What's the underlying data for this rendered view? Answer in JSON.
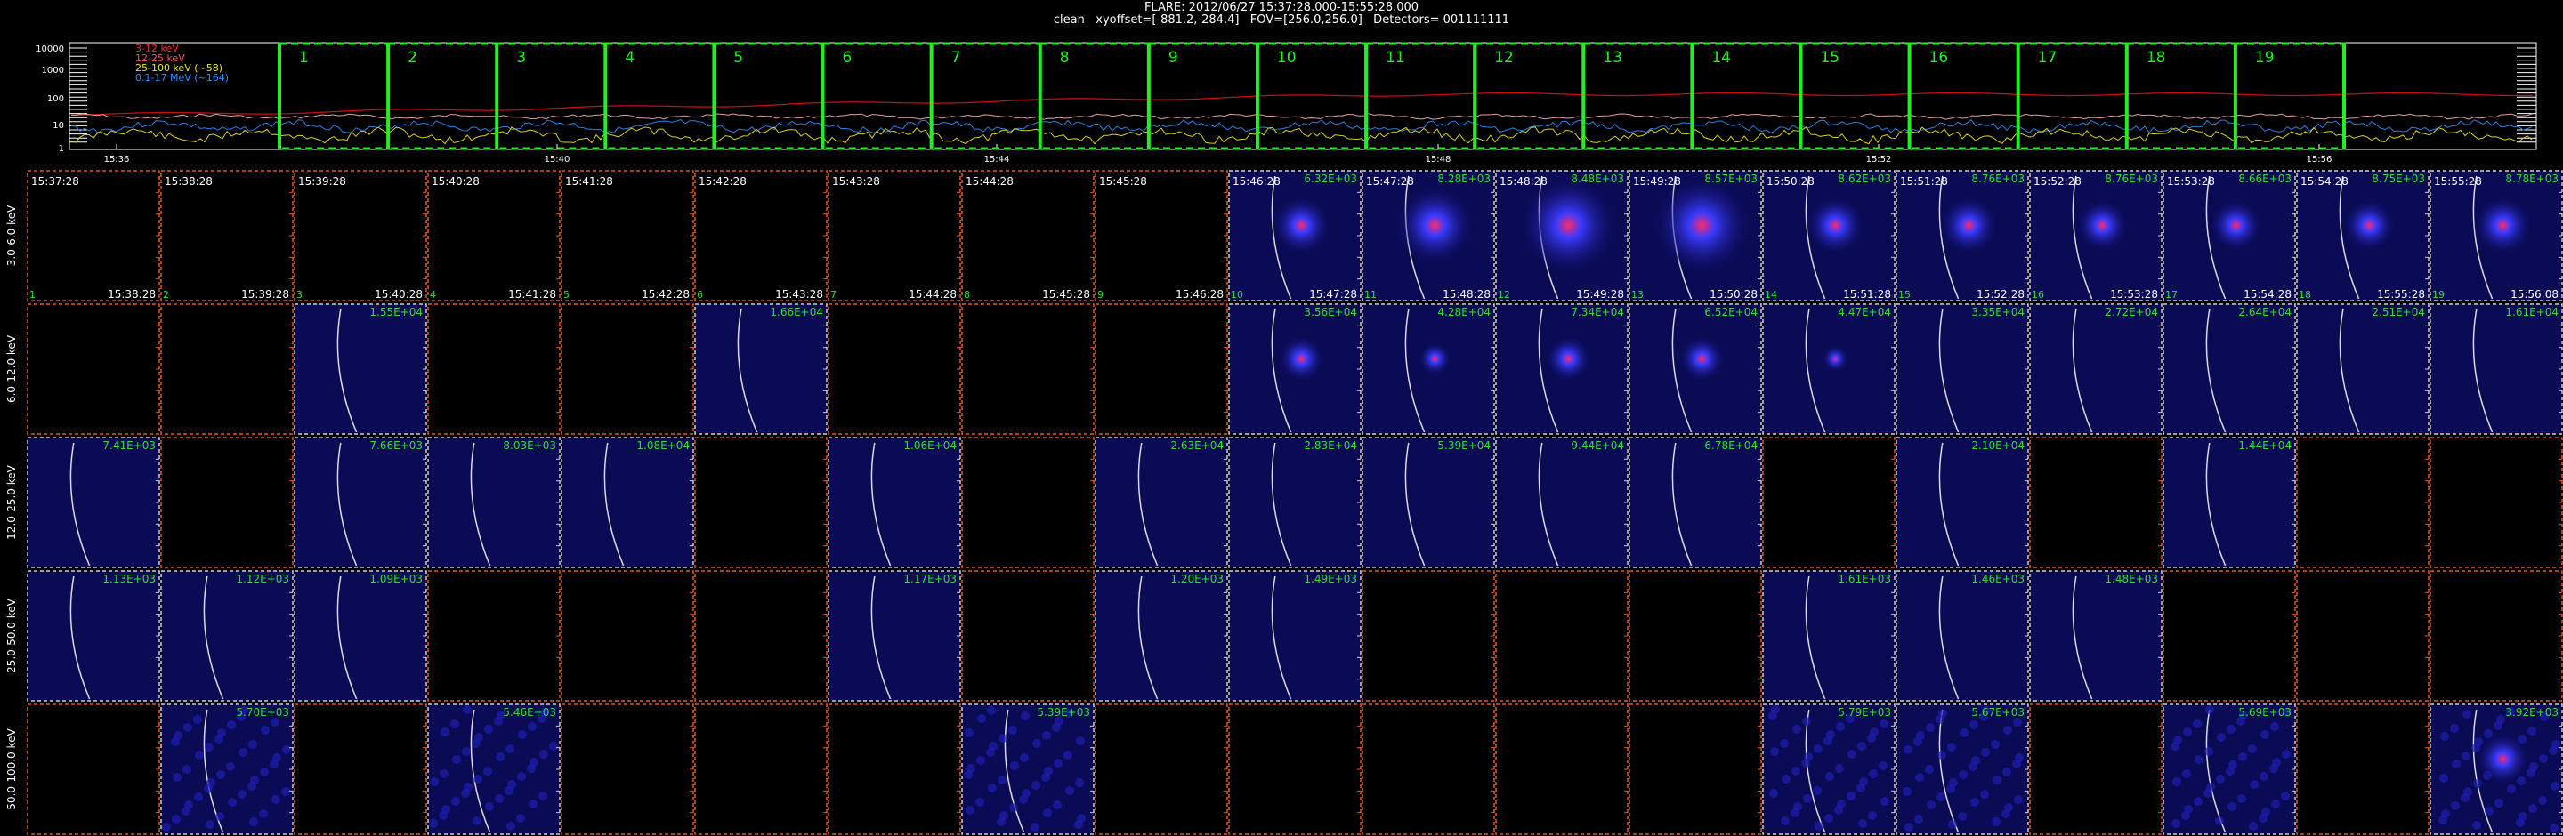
{
  "header": {
    "line1": "FLARE: 2012/06/27 15:37:28.000-15:55:28.000",
    "line2": "clean   xyoffset=[-881.2,-284.4]   FOV=[256.0,256.0]   Detectors= 001111111"
  },
  "lightcurve": {
    "y_ticks": [
      "10000",
      "1000",
      "100",
      "10",
      "1"
    ],
    "x_ticks": [
      "15:36",
      "15:40",
      "15:44",
      "15:48",
      "15:52",
      "15:56"
    ],
    "legend": [
      {
        "label": "3-12 keV",
        "color": "#ff2020"
      },
      {
        "label": "12-25 keV",
        "color": "#ff5050"
      },
      {
        "label": "25-100 keV (~58)",
        "color": "#e8e820"
      },
      {
        "label": "0.1-17 MeV (~164)",
        "color": "#2090ff"
      }
    ],
    "colors": {
      "interval_box": "#22ee22",
      "curve_3_12": "#d01010",
      "curve_12_25": "#e0a0a0",
      "curve_25_100": "#d8d020",
      "curve_mev": "#2a7fe0"
    },
    "intervals": [
      "1",
      "2",
      "3",
      "4",
      "5",
      "6",
      "7",
      "8",
      "9",
      "10",
      "11",
      "12",
      "13",
      "14",
      "15",
      "16",
      "17",
      "18",
      "19"
    ]
  },
  "grid": {
    "colors": {
      "frame_empty": "#e05a1e",
      "frame_image": "#cfcfcf",
      "label_green": "#33dd33",
      "time_white": "#ffffff",
      "image_bg": "#0a0a55",
      "limb": "#dddddd"
    },
    "times": [
      "15:37:28",
      "15:38:28",
      "15:39:28",
      "15:40:28",
      "15:41:28",
      "15:42:28",
      "15:43:28",
      "15:44:28",
      "15:45:28",
      "15:46:28",
      "15:47:28",
      "15:48:28",
      "15:49:28",
      "15:50:28",
      "15:51:28",
      "15:52:28",
      "15:53:28",
      "15:54:28",
      "15:55:28",
      "15:56:08"
    ],
    "rows": [
      {
        "label": "3.0-6.0 keV",
        "cells": [
          "",
          "",
          "",
          "",
          "",
          "",
          "",
          "",
          "",
          "6.32E+03",
          "8.28E+03",
          "8.48E+03",
          "8.57E+03",
          "8.62E+03",
          "8.76E+03",
          "8.76E+03",
          "8.66E+03",
          "8.75E+03",
          "8.78E+03"
        ],
        "blobs": [
          0,
          0,
          0,
          0,
          0,
          0,
          0,
          0,
          0,
          0.9,
          1.2,
          1.5,
          1.5,
          0.9,
          0.9,
          0.8,
          0.8,
          0.8,
          0.9
        ]
      },
      {
        "label": "6.0-12.0 keV",
        "cells": [
          "",
          "",
          "1.55E+04",
          "",
          "",
          "1.66E+04",
          "",
          "",
          "",
          "3.56E+04",
          "4.28E+04",
          "7.34E+04",
          "6.52E+04",
          "4.47E+04",
          "3.35E+04",
          "2.72E+04",
          "2.64E+04",
          "2.51E+04",
          "1.61E+04"
        ],
        "blobs": [
          0,
          0,
          0,
          0,
          0,
          0,
          0,
          0,
          0,
          0.7,
          0.5,
          0.7,
          0.7,
          0.4,
          0,
          0,
          0,
          0,
          0
        ]
      },
      {
        "label": "12.0-25.0 keV",
        "cells": [
          "7.41E+03",
          "",
          "7.66E+03",
          "8.03E+03",
          "1.08E+04",
          "",
          "1.06E+04",
          "",
          "2.63E+04",
          "2.83E+04",
          "5.39E+04",
          "9.44E+04",
          "6.78E+04",
          "",
          "2.10E+04",
          "",
          "1.44E+04",
          "",
          ""
        ],
        "blobs": [
          0,
          0,
          0,
          0,
          0,
          0,
          0,
          0,
          0,
          0,
          0,
          0,
          0,
          0,
          0,
          0,
          0,
          0,
          0
        ]
      },
      {
        "label": "25.0-50.0 keV",
        "cells": [
          "1.13E+03",
          "1.12E+03",
          "1.09E+03",
          "",
          "",
          "",
          "1.17E+03",
          "",
          "1.20E+03",
          "1.49E+03",
          "",
          "",
          "",
          "1.61E+03",
          "1.46E+03",
          "1.48E+03",
          "",
          "",
          ""
        ],
        "blobs": [
          0,
          0,
          0,
          0,
          0,
          0,
          0,
          0,
          0,
          0,
          0,
          0,
          0,
          0,
          0,
          0,
          0,
          0,
          0
        ]
      },
      {
        "label": "50.0-100.0 keV",
        "cells": [
          "",
          "5.70E+03",
          "",
          "5.46E+03",
          "",
          "",
          "",
          "5.39E+03",
          "",
          "",
          "",
          "",
          "",
          "5.79E+03",
          "5.67E+03",
          "",
          "5.69E+03",
          "",
          "3.92E+03"
        ],
        "blobs": [
          0,
          0,
          0,
          0,
          0,
          0,
          0,
          0,
          0,
          0,
          0,
          0,
          0,
          0,
          0,
          0,
          0,
          0,
          0.8
        ]
      }
    ]
  }
}
